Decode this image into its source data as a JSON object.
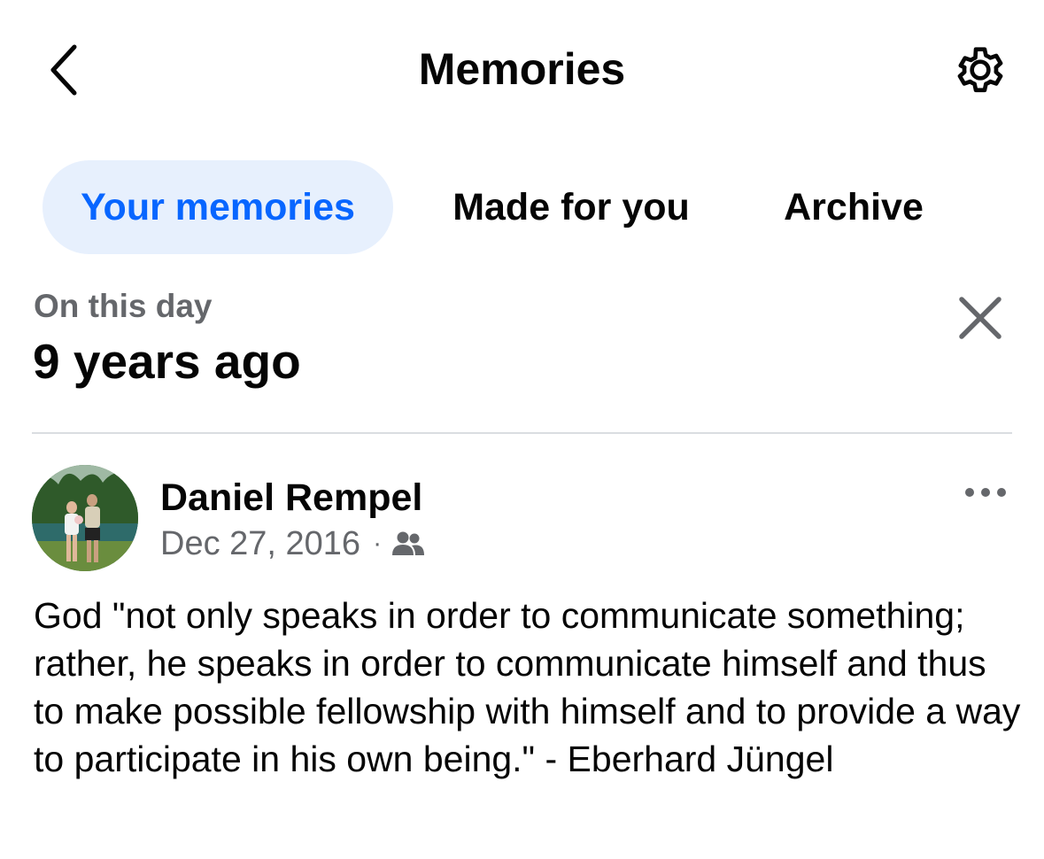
{
  "header": {
    "title": "Memories",
    "back_icon": "chevron-left-icon",
    "settings_icon": "gear-icon"
  },
  "tabs": [
    {
      "label": "Your memories",
      "active": true
    },
    {
      "label": "Made for you",
      "active": false
    },
    {
      "label": "Archive",
      "active": false
    }
  ],
  "memory": {
    "on_this_day": "On this day",
    "years_ago": "9 years ago",
    "close_icon": "close-icon"
  },
  "post": {
    "author": "Daniel Rempel",
    "date": "Dec 27, 2016",
    "separator": "·",
    "audience_icon": "friends-icon",
    "more_icon": "more-horizontal-icon",
    "text": "God \"not only speaks in order to communicate something; rather, he speaks in order to communicate himself and thus to make possible fellowship with himself and to provide a way to participate in his own being.\" - Eberhard Jüngel"
  },
  "colors": {
    "accent": "#0866ff",
    "active_tab_bg": "#e7f0fd",
    "secondary_text": "#65676b",
    "primary_text": "#050505",
    "divider": "#dadde1"
  }
}
